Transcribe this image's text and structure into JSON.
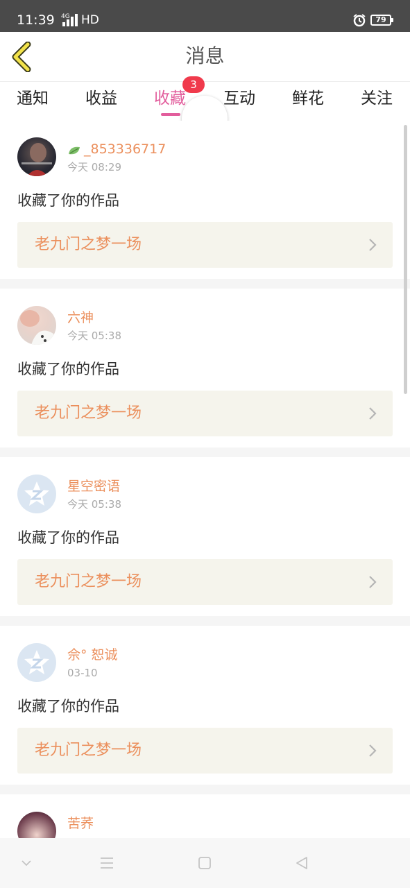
{
  "status_bar": {
    "time": "11:39",
    "network": "4G",
    "hd": "HD",
    "battery": "79"
  },
  "header": {
    "title": "消息"
  },
  "tabs": [
    {
      "label": "通知"
    },
    {
      "label": "收益"
    },
    {
      "label": "收藏",
      "active": true,
      "badge": "3"
    },
    {
      "label": "互动"
    },
    {
      "label": "鲜花"
    },
    {
      "label": "关注"
    }
  ],
  "messages": [
    {
      "username": "_853336717",
      "time": "今天 08:29",
      "action": "收藏了你的作品",
      "work": "老九门之梦一场"
    },
    {
      "username": "六神",
      "time": "今天 05:38",
      "action": "收藏了你的作品",
      "work": "老九门之梦一场"
    },
    {
      "username": "星空密语",
      "time": "今天 05:38",
      "action": "收藏了你的作品",
      "work": "老九门之梦一场"
    },
    {
      "username": "佘° 恕诚",
      "time": "03-10",
      "action": "收藏了你的作品",
      "work": "老九门之梦一场"
    },
    {
      "username": "苦荞"
    }
  ],
  "colors": {
    "accent": "#e25d9c",
    "name": "#eb8f5c",
    "badge": "#f03a4c",
    "card_bg": "#f5f4ec"
  }
}
